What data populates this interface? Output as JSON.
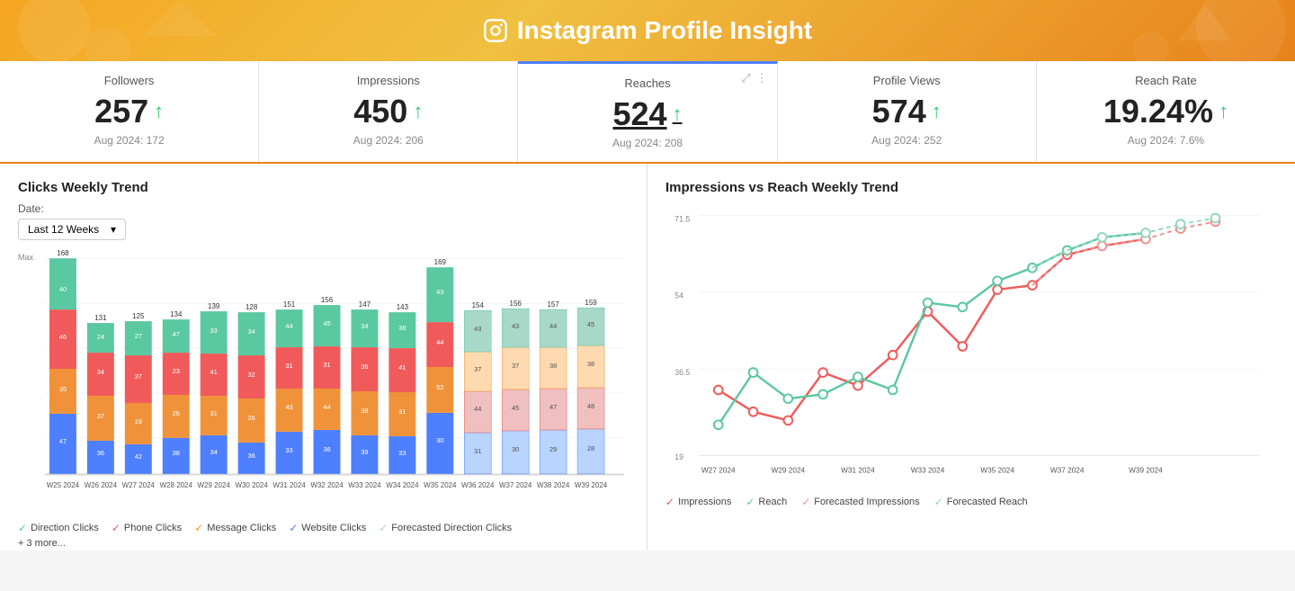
{
  "header": {
    "title": "Instagram Profile Insight",
    "icon": "instagram"
  },
  "stats": [
    {
      "label": "Followers",
      "value": "257",
      "arrow": "↑",
      "prev": "Aug 2024: 172",
      "active": false,
      "underline": false
    },
    {
      "label": "Impressions",
      "value": "450",
      "arrow": "↑",
      "prev": "Aug 2024: 206",
      "active": false,
      "underline": false
    },
    {
      "label": "Reaches",
      "value": "524",
      "arrow": "↑",
      "prev": "Aug 2024: 208",
      "active": true,
      "underline": true
    },
    {
      "label": "Profile Views",
      "value": "574",
      "arrow": "↑",
      "prev": "Aug 2024: 252",
      "active": false,
      "underline": false
    },
    {
      "label": "Reach Rate",
      "value": "19.24%",
      "arrow": "↑",
      "prev": "Aug 2024: 7.6%",
      "active": false,
      "underline": false
    }
  ],
  "left_panel": {
    "title": "Clicks Weekly Trend",
    "date_label": "Date:",
    "date_value": "Last 12 Weeks",
    "legend": [
      {
        "label": "Direction Clicks",
        "color": "#5ac8a0"
      },
      {
        "label": "Phone Clicks",
        "color": "#f05a5a"
      },
      {
        "label": "Message Clicks",
        "color": "#f0923a"
      },
      {
        "label": "Website Clicks",
        "color": "#4e7fff"
      },
      {
        "label": "Forecasted Direction Clicks",
        "color": "#a8d8c8"
      }
    ],
    "more": "+ 3 more..."
  },
  "right_panel": {
    "title": "Impressions vs Reach Weekly Trend",
    "legend": [
      {
        "label": "Impressions",
        "color": "#f05a5a"
      },
      {
        "label": "Reach",
        "color": "#5ac8a0"
      },
      {
        "label": "Forecasted Impressions",
        "color": "#f09090"
      },
      {
        "label": "Forecasted Reach",
        "color": "#90d8b8"
      }
    ]
  }
}
